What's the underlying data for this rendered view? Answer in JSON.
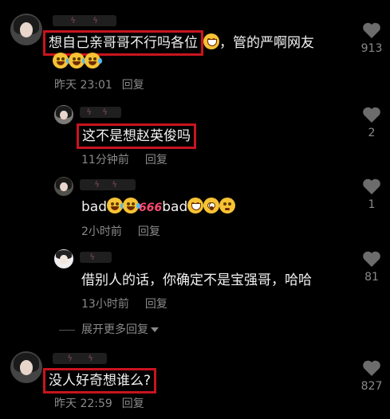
{
  "comments": [
    {
      "text_highlight": "想自己亲哥哥不行吗各位",
      "text_rest": "，管的严啊网友",
      "time": "昨天 23:01",
      "reply": "回复",
      "likes": "913",
      "emoji_main": "grin-sweat-emoji",
      "emoji_line2": [
        "laugh-cry-emoji",
        "laugh-cry-emoji",
        "laugh-cry-emoji"
      ]
    },
    {
      "text_highlight": "这不是想赵英俊吗",
      "time": "11分钟前",
      "reply": "回复",
      "likes": "2"
    },
    {
      "text_a": "bad",
      "six": "666",
      "text_b": "bad",
      "time": "2小时前",
      "reply": "回复",
      "likes": "1"
    },
    {
      "text": "借别人的话，你确定不是宝强哥，哈哈",
      "time": "13小时前",
      "reply": "回复",
      "likes": "81"
    },
    {
      "text_highlight": "没人好奇想谁么?",
      "time": "昨天 22:59",
      "reply": "回复",
      "likes": "827"
    }
  ],
  "expand_more": "展开更多回复",
  "colors": {
    "highlight": "#c8141e",
    "background": "#000000",
    "meta": "#8a8a8a"
  }
}
